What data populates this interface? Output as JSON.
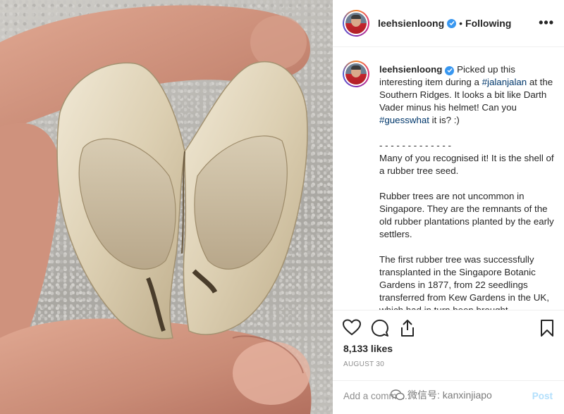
{
  "post": {
    "username": "leehsienloong",
    "follow_status": "Following",
    "separator": "•",
    "more_icon": "•••"
  },
  "caption": {
    "username": "leehsienloong",
    "line1_before": "Picked up this interesting item during a ",
    "tag1": "#jalanjalan",
    "line1_after": " at the Southern Ridges. It looks a bit like Darth Vader minus his helmet! Can you ",
    "tag2": "#guesswhat",
    "line1_end": " it is? :)",
    "divider": "- - - - - - - - - - - - -",
    "para2": "Many of you recognised it! It is the shell of a rubber tree seed.",
    "para3": "Rubber trees are not uncommon in Singapore. They are the remnants of the old rubber plantations planted by the early settlers.",
    "para4": "The first rubber tree was successfully transplanted in the Singapore Botanic Gardens in 1877, from 22 seedlings transferred from Kew Gardens in the UK, which had in turn been brought"
  },
  "actions": {
    "likes": "8,133 likes",
    "date": "AUGUST 30",
    "icons": [
      "heart-icon",
      "comment-icon",
      "share-icon",
      "bookmark-icon"
    ]
  },
  "add_comment": {
    "placeholder": "Add a comme...",
    "post_label": "Post",
    "watermark": "微信号: kanxinjiapo"
  },
  "colors": {
    "verified": "#3897f0",
    "hashtag": "#00376b",
    "muted": "#8e8e8e"
  }
}
